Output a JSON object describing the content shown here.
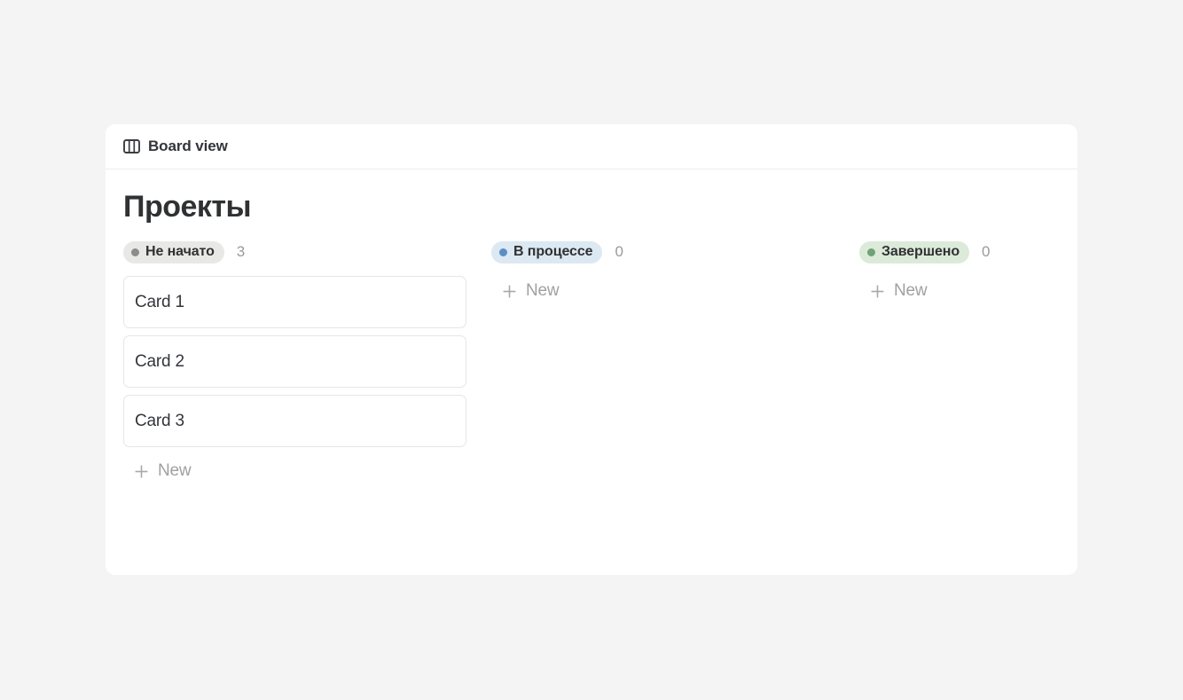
{
  "page": {
    "background_color": "#f4f4f4",
    "panel_background": "#ffffff"
  },
  "view_header": {
    "icon": "board-view-icon",
    "label": "Board view"
  },
  "board": {
    "title": "Проекты",
    "columns": [
      {
        "status": "Не начато",
        "count": "3",
        "dot_color": "#8c8c8a",
        "pill_color": "#e8e8e6",
        "cards": [
          {
            "title": "Card 1"
          },
          {
            "title": "Card 2"
          },
          {
            "title": "Card 3"
          }
        ],
        "new_label": "New"
      },
      {
        "status": "В процессе",
        "count": "0",
        "dot_color": "#5b8fc4",
        "pill_color": "#dce8f2",
        "cards": [],
        "new_label": "New"
      },
      {
        "status": "Завершено",
        "count": "0",
        "dot_color": "#6fa377",
        "pill_color": "#dcead9",
        "cards": [],
        "new_label": "New"
      }
    ]
  },
  "icons": {
    "plus": "plus-icon",
    "board": "board-view-icon"
  }
}
